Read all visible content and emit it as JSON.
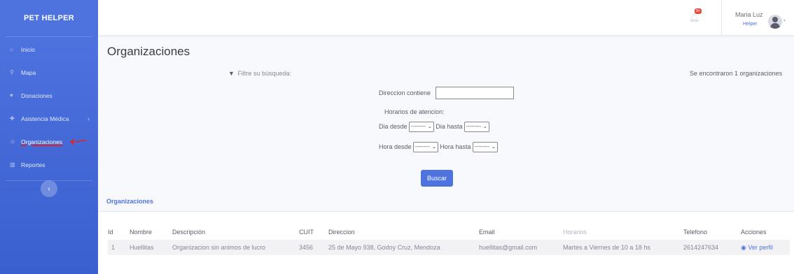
{
  "sidebar": {
    "brand": "PET HELPER",
    "items": [
      {
        "label": "Inicio",
        "icon": "home-icon"
      },
      {
        "label": "Mapa",
        "icon": "map-marker-icon"
      },
      {
        "label": "Donaciones",
        "icon": "donation-icon"
      },
      {
        "label": "Asistencia Médica",
        "icon": "medkit-icon"
      },
      {
        "label": "Organizaciones",
        "icon": "users-icon"
      },
      {
        "label": "Reportes",
        "icon": "chart-icon"
      }
    ],
    "toggle": "‹"
  },
  "topbar": {
    "notification_count": "3+",
    "user_name": "Maria Luz",
    "user_role": "Helper"
  },
  "page": {
    "title": "Organizaciones",
    "filter_label": "Filtre su búsqueda:",
    "found_text": "Se encontraron 1 organizaciones",
    "direccion_label": "Direccion contiene",
    "direccion_value": "",
    "horarios_label": "Horarios de atencion:",
    "dia_desde_label": "Dia desde",
    "dia_hasta_label": "Dia hasta",
    "hora_desde_label": "Hora desde",
    "hora_hasta_label": "Hora hasta",
    "select_empty": "---------",
    "search_button": "Buscar"
  },
  "table": {
    "card_title": "Organizaciones",
    "headers": [
      "Id",
      "Nombre",
      "Descripción",
      "CUIT",
      "Direccion",
      "Email",
      "Horarios",
      "Telefono",
      "Acciones"
    ],
    "rows": [
      [
        "1",
        "Huellitas",
        "Organizacion sin animos de lucro",
        "3456",
        "25 de Mayo 938, Godoy Cruz, Mendoza",
        "huellitas@gmail.com",
        "Martes a Viernes de 10 a 18 hs",
        "2614247634",
        "Ver perfil"
      ]
    ]
  },
  "colors": {
    "primary": "#4e73df",
    "danger": "#e74a3b",
    "annotation": "#e02424"
  }
}
